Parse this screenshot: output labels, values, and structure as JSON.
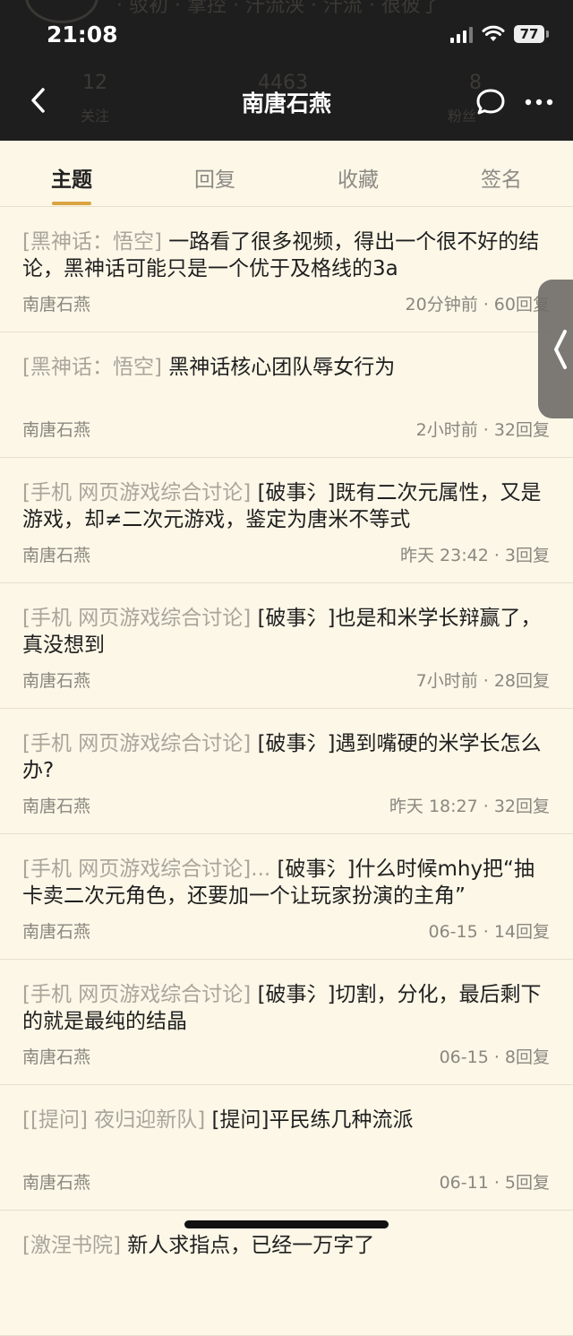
{
  "status": {
    "time": "21:08",
    "battery": "77"
  },
  "ghost": {
    "header_text": "· 驳初 · 掌控 · 汗流浃 · 汗流 · 很彼了",
    "stats": [
      "12",
      "4463",
      "8"
    ],
    "stat_labels": [
      "关注",
      "粉丝"
    ]
  },
  "nav": {
    "title": "南唐石燕",
    "back_icon": "back-chevron-icon",
    "chat_icon": "chat-bubble-icon",
    "more_icon": "more-dots-icon"
  },
  "tabs": [
    {
      "label": "主题"
    },
    {
      "label": "回复"
    },
    {
      "label": "收藏"
    },
    {
      "label": "签名"
    }
  ],
  "posts": [
    {
      "forum": "[黑神话：悟空]",
      "title": " 一路看了很多视频，得出一个很不好的结论，黑神话可能只是一个优于及格线的3a",
      "author": "南唐石燕",
      "meta": "20分钟前 · 60回复"
    },
    {
      "forum": "[黑神话：悟空]",
      "title": " 黑神话核心团队辱女行为",
      "author": "南唐石燕",
      "meta": "2小时前 · 32回复"
    },
    {
      "forum": "[手机 网页游戏综合讨论]",
      "title": " [破事氵]既有二次元属性，又是游戏，却≠二次元游戏，鉴定为唐米不等式",
      "author": "南唐石燕",
      "meta": "昨天 23:42 · 3回复"
    },
    {
      "forum": "[手机 网页游戏综合讨论]",
      "title": " [破事氵]也是和米学长辩赢了，真没想到",
      "author": "南唐石燕",
      "meta": "7小时前 · 28回复"
    },
    {
      "forum": "[手机 网页游戏综合讨论]",
      "title": " [破事氵]遇到嘴硬的米学长怎么办?",
      "author": "南唐石燕",
      "meta": "昨天 18:27 · 32回复"
    },
    {
      "forum": "[手机 网页游戏综合讨论]...",
      "title": " [破事氵]什么时候mhy把“抽卡卖二次元角色，还要加一个让玩家扮演的主角”",
      "author": "南唐石燕",
      "meta": "06-15 · 14回复"
    },
    {
      "forum": "[手机 网页游戏综合讨论]",
      "title": " [破事氵]切割，分化，最后剩下的就是最纯的结晶",
      "author": "南唐石燕",
      "meta": "06-15 · 8回复"
    },
    {
      "forum": "[[提问] 夜归迎新队]",
      "title": " [提问]平民练几种流派",
      "author": "南唐石燕",
      "meta": "06-11 · 5回复"
    },
    {
      "forum": "[激涅书院]",
      "title": " 新人求指点，已经一万字了",
      "author": "",
      "meta": ""
    }
  ],
  "colors": {
    "header_bg": "#1e1e1e",
    "page_bg": "#fcf7e7",
    "accent": "#d9a441"
  }
}
